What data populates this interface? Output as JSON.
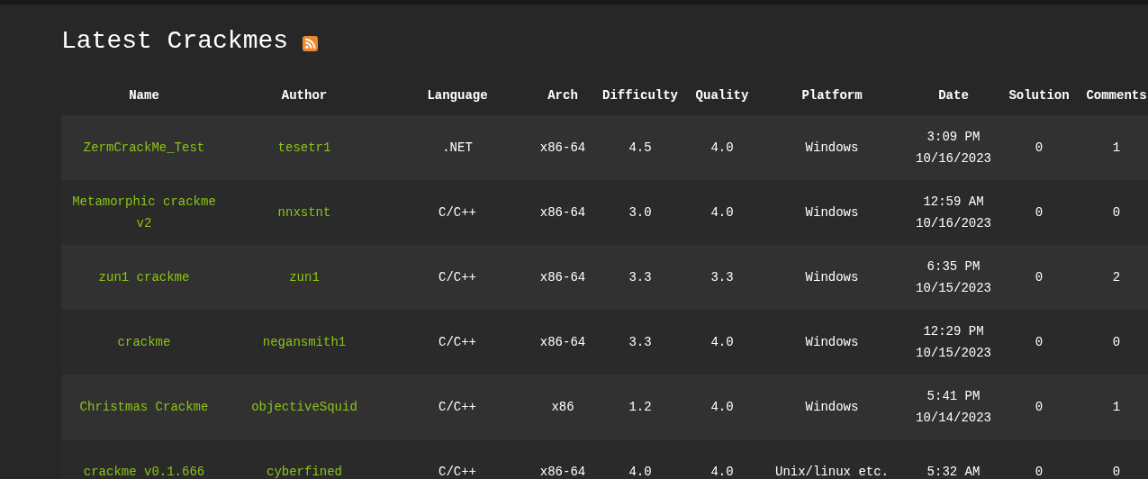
{
  "title": "Latest Crackmes",
  "table": {
    "columns": [
      "Name",
      "Author",
      "Language",
      "Arch",
      "Difficulty",
      "Quality",
      "Platform",
      "Date",
      "Solution",
      "Comments"
    ],
    "rows": [
      {
        "name": "ZermCrackMe_Test",
        "author": "tesetr1",
        "language": ".NET",
        "arch": "x86-64",
        "difficulty": "4.5",
        "quality": "4.0",
        "platform": "Windows",
        "date": [
          "3:09 PM",
          "10/16/2023"
        ],
        "solution": "0",
        "comments": "1"
      },
      {
        "name": "Metamorphic crackme v2",
        "author": "nnxstnt",
        "language": "C/C++",
        "arch": "x86-64",
        "difficulty": "3.0",
        "quality": "4.0",
        "platform": "Windows",
        "date": [
          "12:59 AM",
          "10/16/2023"
        ],
        "solution": "0",
        "comments": "0"
      },
      {
        "name": "zun1 crackme",
        "author": "zun1",
        "language": "C/C++",
        "arch": "x86-64",
        "difficulty": "3.3",
        "quality": "3.3",
        "platform": "Windows",
        "date": [
          "6:35 PM",
          "10/15/2023"
        ],
        "solution": "0",
        "comments": "2"
      },
      {
        "name": "crackme",
        "author": "negansmith1",
        "language": "C/C++",
        "arch": "x86-64",
        "difficulty": "3.3",
        "quality": "4.0",
        "platform": "Windows",
        "date": [
          "12:29 PM",
          "10/15/2023"
        ],
        "solution": "0",
        "comments": "0"
      },
      {
        "name": "Christmas Crackme",
        "author": "objectiveSquid",
        "language": "C/C++",
        "arch": "x86",
        "difficulty": "1.2",
        "quality": "4.0",
        "platform": "Windows",
        "date": [
          "5:41 PM",
          "10/14/2023"
        ],
        "solution": "0",
        "comments": "1"
      },
      {
        "name": "crackme v0.1.666",
        "author": "cyberfined",
        "language": "C/C++",
        "arch": "x86-64",
        "difficulty": "4.0",
        "quality": "4.0",
        "platform": "Unix/linux etc.",
        "date": [
          "5:32 AM"
        ],
        "solution": "0",
        "comments": "0"
      }
    ]
  }
}
